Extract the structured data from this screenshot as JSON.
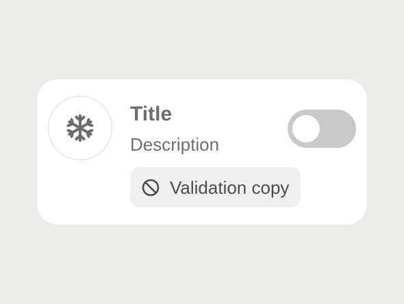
{
  "card": {
    "icon": "snowflake-icon",
    "title": "Title",
    "description": "Description",
    "toggle": {
      "state": "off",
      "track_color": "#c9c9c9",
      "knob_color": "#ffffff"
    },
    "validation": {
      "icon": "prohibited-icon",
      "text": "Validation copy"
    }
  },
  "colors": {
    "background": "#ecedeb",
    "card": "#ffffff",
    "icon": "#6d6d6d"
  }
}
